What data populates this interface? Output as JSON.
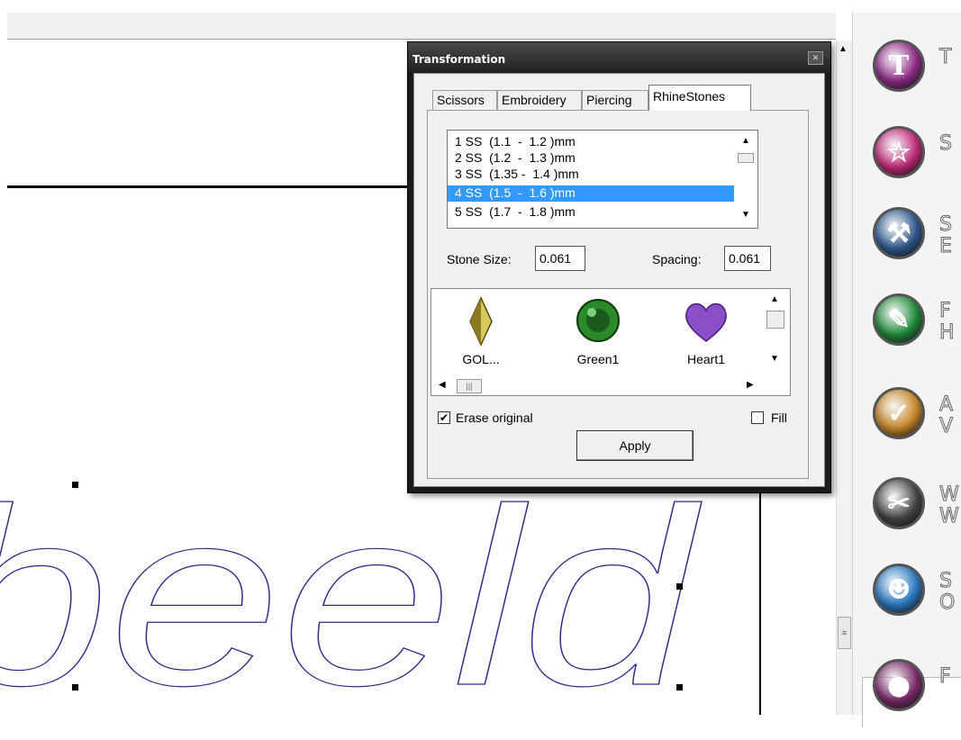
{
  "dialog": {
    "title": "Transformation",
    "close_icon": "close-icon",
    "tabs": [
      {
        "label": "Scissors",
        "active": false
      },
      {
        "label": "Embroidery",
        "active": false
      },
      {
        "label": "Piercing",
        "active": false
      },
      {
        "label": "RhineStones",
        "active": true
      }
    ],
    "size_list": [
      {
        "label": "1 SS  (1.1  -  1.2 )mm",
        "selected": false
      },
      {
        "label": "2 SS  (1.2  -  1.3 )mm",
        "selected": false
      },
      {
        "label": "3 SS  (1.35 -  1.4 )mm",
        "selected": false
      },
      {
        "label": "4 SS  (1.5  -  1.6 )mm",
        "selected": true
      },
      {
        "label": "5 SS  (1.7  -  1.8 )mm",
        "selected": false
      }
    ],
    "stone_size_label": "Stone Size:",
    "stone_size_value": "0.061",
    "spacing_label": "Spacing:",
    "spacing_value": "0.061",
    "stones": [
      {
        "name": "GOL...",
        "icon": "gold-navette-stone-icon",
        "color": "#b8a83a"
      },
      {
        "name": "Green1",
        "icon": "green-round-stone-icon",
        "color": "#1f7a1f"
      },
      {
        "name": "Heart1",
        "icon": "purple-heart-stone-icon",
        "color": "#7a3fb0"
      }
    ],
    "erase_original_label": "Erase original",
    "erase_original_checked": true,
    "fill_label": "Fill",
    "fill_checked": false,
    "apply_label": "Apply"
  },
  "canvas": {
    "text": "beeld"
  },
  "palette": {
    "items": [
      {
        "icon": "text-tool-icon",
        "glyph": "T",
        "color": "#8e2a86",
        "label": "T"
      },
      {
        "icon": "shape-star-icon",
        "glyph": "☆",
        "color": "#c02a7a",
        "label": "S"
      },
      {
        "icon": "tools-icon",
        "glyph": "⚒",
        "color": "#2f5a8f",
        "label": "S\nE"
      },
      {
        "icon": "pen-tool-icon",
        "glyph": "✎",
        "color": "#1f8a3a",
        "label": "F\nH"
      },
      {
        "icon": "check-badge-icon",
        "glyph": "✓",
        "color": "#c9872a",
        "label": "A\nV"
      },
      {
        "icon": "eye-scissors-icon",
        "glyph": "✂",
        "color": "#444444",
        "label": "W\nW"
      },
      {
        "icon": "people-share-icon",
        "glyph": "☻",
        "color": "#2a78c0",
        "label": "S\nO"
      },
      {
        "icon": "rhinestone-icon",
        "glyph": "●",
        "color": "#7a2a6a",
        "label": "F"
      }
    ]
  }
}
